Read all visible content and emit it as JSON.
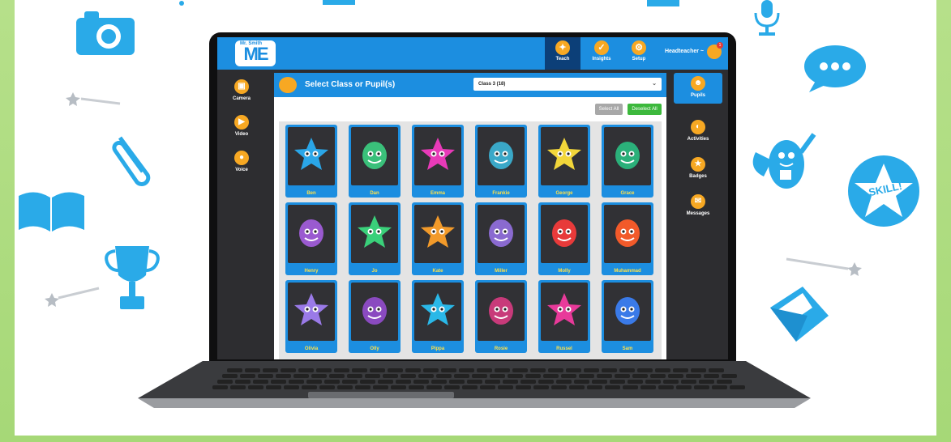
{
  "brand": {
    "logo_top": "Mr. Smith",
    "logo_main": "ME"
  },
  "topnav": [
    {
      "label": "Teach",
      "icon": "teach-icon",
      "active": true
    },
    {
      "label": "Insights",
      "icon": "insights-icon",
      "active": false
    },
    {
      "label": "Setup",
      "icon": "setup-icon",
      "active": false
    }
  ],
  "user": {
    "label": "Headteacher ~",
    "notifications": "1"
  },
  "left_sidebar": [
    {
      "label": "Camera",
      "icon": "camera-icon"
    },
    {
      "label": "Video",
      "icon": "video-icon"
    },
    {
      "label": "Voice",
      "icon": "microphone-icon"
    }
  ],
  "right_sidebar": [
    {
      "label": "Pupils",
      "icon": "pupils-icon",
      "active": true
    },
    {
      "label": "Activities",
      "icon": "activities-icon",
      "active": false
    },
    {
      "label": "Badges",
      "icon": "badges-icon",
      "active": false
    },
    {
      "label": "Messages",
      "icon": "messages-icon",
      "active": false
    }
  ],
  "panel": {
    "title": "Select Class or Pupil(s)",
    "class_select": "Class 3 (18)",
    "select_all": "Select All",
    "deselect_all": "Deselect All"
  },
  "pupils": [
    {
      "name": "Ben",
      "avatar": "star",
      "color": "#2aa6e8"
    },
    {
      "name": "Dan",
      "avatar": "monster",
      "color": "#3ac07a"
    },
    {
      "name": "Emma",
      "avatar": "star",
      "color": "#e83ab8"
    },
    {
      "name": "Frankie",
      "avatar": "monster",
      "color": "#3aa8c8"
    },
    {
      "name": "George",
      "avatar": "star",
      "color": "#f2d63a"
    },
    {
      "name": "Grace",
      "avatar": "monster",
      "color": "#2bb07a"
    },
    {
      "name": "Henry",
      "avatar": "monster",
      "color": "#9a5ad0"
    },
    {
      "name": "Jo",
      "avatar": "star",
      "color": "#3ad07a"
    },
    {
      "name": "Kate",
      "avatar": "star",
      "color": "#f29a2a"
    },
    {
      "name": "Miller",
      "avatar": "monster",
      "color": "#8a6ad0"
    },
    {
      "name": "Molly",
      "avatar": "monster",
      "color": "#e83a3a"
    },
    {
      "name": "Muhammad",
      "avatar": "monster",
      "color": "#f25a2a"
    },
    {
      "name": "Olivia",
      "avatar": "star",
      "color": "#9a7ae8"
    },
    {
      "name": "Olly",
      "avatar": "monster",
      "color": "#8a4ac0"
    },
    {
      "name": "Pippa",
      "avatar": "star",
      "color": "#2ab8e8"
    },
    {
      "name": "Rosie",
      "avatar": "monster",
      "color": "#c83a7a"
    },
    {
      "name": "Russel",
      "avatar": "star",
      "color": "#e83a9a"
    },
    {
      "name": "Sam",
      "avatar": "monster",
      "color": "#3a7ae8"
    }
  ],
  "decorations": {
    "skill_badge": "SKILL!"
  },
  "colors": {
    "accent": "#1c8ee0",
    "orange": "#f7a823",
    "green": "#3cb83c",
    "name_text": "#ffe24a"
  }
}
